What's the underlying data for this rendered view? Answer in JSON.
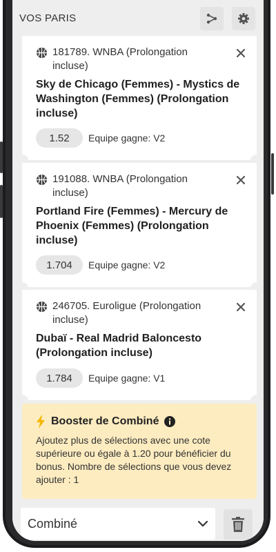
{
  "header": {
    "title": "VOS PARIS",
    "share_icon": "share-icon",
    "settings_icon": "gear-icon"
  },
  "bets": [
    {
      "league": "181789. WNBA (Prolongation incluse)",
      "match": "Sky de Chicago (Femmes) - Mystics de Washington (Femmes) (Prolongation incluse)",
      "odds": "1.52",
      "selection": "Equipe gagne: V2"
    },
    {
      "league": "191088. WNBA (Prolongation incluse)",
      "match": "Portland Fire (Femmes) - Mercury de Phoenix (Femmes) (Prolongation incluse)",
      "odds": "1.704",
      "selection": "Equipe gagne: V2"
    },
    {
      "league": "246705. Euroligue (Prolongation incluse)",
      "match": "Dubaï - Real Madrid Baloncesto (Prolongation incluse)",
      "odds": "1.784",
      "selection": "Equipe gagne: V1"
    }
  ],
  "booster": {
    "title": "Booster de Combiné",
    "text": "Ajoutez plus de sélections avec une cote supérieure ou égale à 1.20 pour bénéficier du bonus. Nombre de sélections que vous devez ajouter : 1",
    "accent_color": "#f5b800"
  },
  "footer": {
    "bet_type": "Combiné"
  },
  "colors": {
    "booster_bg": "#fdecc0",
    "screen_bg": "#eeeeee",
    "card_bg": "#ffffff"
  }
}
